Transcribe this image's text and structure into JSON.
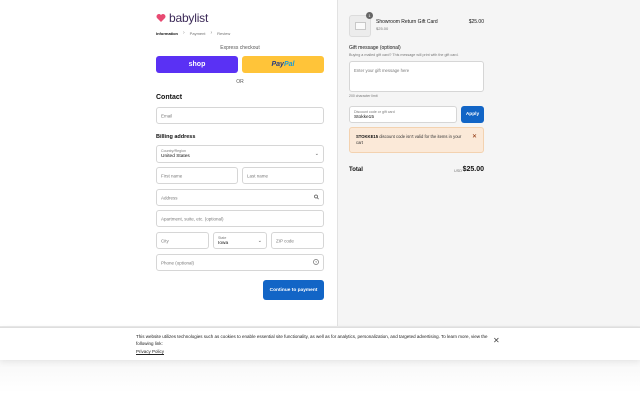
{
  "brand": {
    "name": "babylist",
    "heart_color": "#e84a72",
    "text_color": "#3c2a58"
  },
  "breadcrumb": {
    "items": [
      "Information",
      "Payment",
      "Review"
    ],
    "separator": "›"
  },
  "express": {
    "label": "Express checkout",
    "shop_label": "shop",
    "paypal_label_1": "Pay",
    "paypal_label_2": "Pal",
    "or_label": "OR"
  },
  "contact": {
    "title": "Contact",
    "email_placeholder": "Email"
  },
  "billing": {
    "title": "Billing address",
    "country_label": "Country/Region",
    "country_value": "United States",
    "first_name_placeholder": "First name",
    "last_name_placeholder": "Last name",
    "address_placeholder": "Address",
    "apartment_placeholder": "Apartment, suite, etc. (optional)",
    "city_placeholder": "City",
    "state_label": "State",
    "state_value": "Iowa",
    "zip_placeholder": "ZIP code",
    "phone_placeholder": "Phone (optional)"
  },
  "continue_label": "Continue to payment",
  "order": {
    "quantity": "1",
    "item_name": "Showroom Return Gift Card",
    "item_sub": "$25.00",
    "item_price": "$25.00",
    "gift_message_label": "Gift message (optional)",
    "gift_message_hint": "Buying a mailed gift card? This message will print with the gift card.",
    "gift_message_placeholder": "Enter your gift message here",
    "char_limit": "200 character limit",
    "discount_label": "Discount code or gift card",
    "discount_value": "Stokke15",
    "apply_label": "Apply",
    "alert_code": "STOKKE15",
    "alert_text": " discount code isn't valid for the items in your cart",
    "total_label": "Total",
    "total_currency": "USD",
    "total_value": "$25.00"
  },
  "cookie": {
    "text": "This website utilizes technologies such as cookies to enable essential site functionality, as well as for analytics, personalization, and targeted advertising. To learn more, view the following link:",
    "link": "Privacy Policy"
  },
  "colors": {
    "primary_button": "#1265c6",
    "shop_button": "#5a31f4",
    "paypal_button": "#ffc439",
    "alert_bg": "#fbe9d8"
  }
}
